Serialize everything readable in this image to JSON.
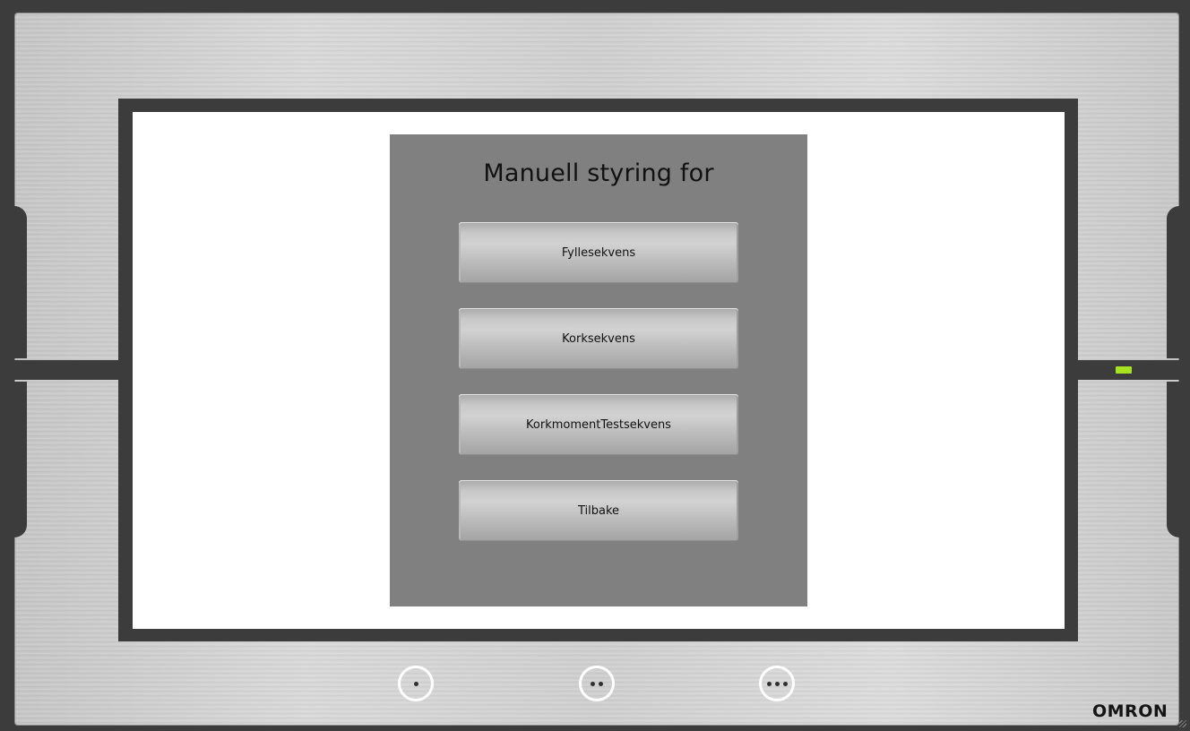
{
  "hmi": {
    "panel_title": "Manuell styring for",
    "buttons": [
      {
        "label": "Fyllesekvens"
      },
      {
        "label": "Korksekvens"
      },
      {
        "label": "KorkmomentTestsekvens"
      },
      {
        "label": "Tilbake"
      }
    ]
  },
  "bezel": {
    "brand_logo": "OMRON",
    "status_led_color": "#a6e21e",
    "function_keys": [
      {
        "name": "function-key-1",
        "dots": 1
      },
      {
        "name": "function-key-2",
        "dots": 2
      },
      {
        "name": "function-key-3",
        "dots": 3
      }
    ]
  }
}
